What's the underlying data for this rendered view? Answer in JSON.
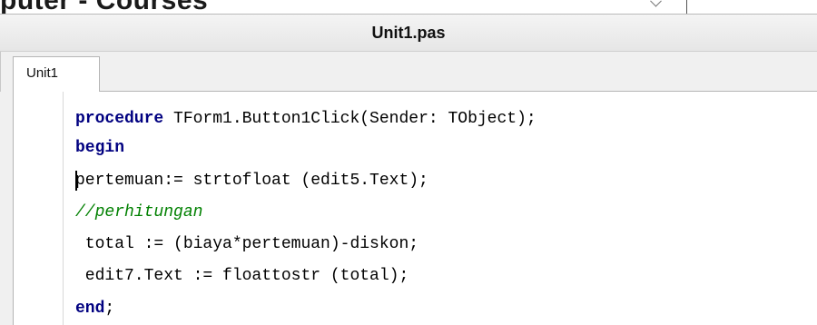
{
  "background_window": {
    "title_fragment": "puter - Courses"
  },
  "window": {
    "title": "Unit1.pas"
  },
  "tabs": [
    {
      "label": "Unit1"
    }
  ],
  "editor": {
    "lines": [
      {
        "kw": "procedure",
        "text": " TForm1.Button1Click(Sender: TObject);"
      },
      {
        "kw": "begin",
        "text": ""
      },
      {
        "kw": "",
        "text": "pertemuan:= strtofloat (edit5.Text);"
      },
      {
        "comment": "//perhitungan"
      },
      {
        "kw": "",
        "text": " total := (biaya*pertemuan)-diskon;"
      },
      {
        "kw": "",
        "text": " edit7.Text := floattostr (total);"
      },
      {
        "kw": "end",
        "text": ";"
      }
    ]
  }
}
